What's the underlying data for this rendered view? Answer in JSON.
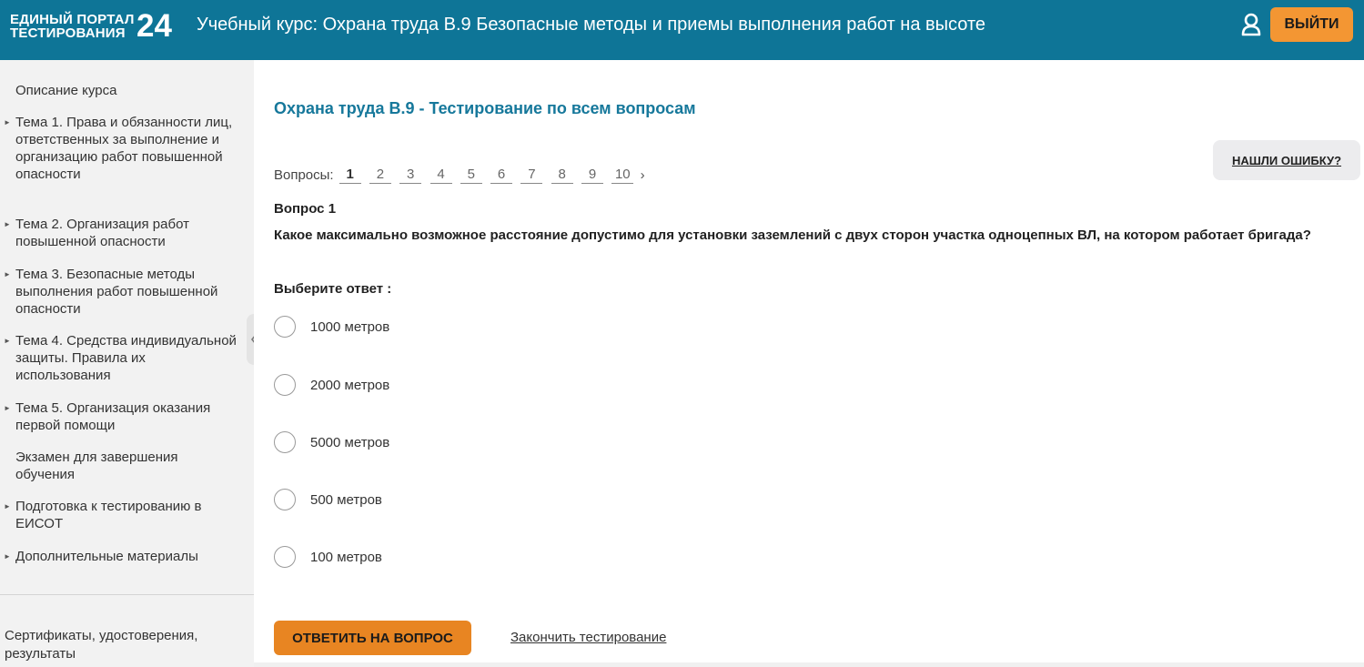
{
  "header": {
    "logo_line1": "ЕДИНЫЙ ПОРТАЛ",
    "logo_line2": "ТЕСТИРОВАНИЯ",
    "logo_number": "24",
    "title": "Учебный курс: Охрана труда В.9 Безопасные методы и приемы выполнения работ на высоте",
    "logout_label": "ВЫЙТИ",
    "user_icon": "user-icon"
  },
  "sidebar": {
    "items": [
      {
        "label": "Описание курса",
        "arrow": false
      },
      {
        "label": "Тема 1. Права и обязанности лиц, ответственных за выполнение и организацию работ повышенной опасности",
        "arrow": true
      },
      {
        "label": "Тема 2. Организация работ повышенной опасности",
        "arrow": true
      },
      {
        "label": "Тема 3. Безопасные методы выполнения работ повышенной опасности",
        "arrow": true
      },
      {
        "label": "Тема 4. Средства индивидуальной защиты. Правила их использования",
        "arrow": true
      },
      {
        "label": "Тема 5. Организация оказания первой помощи",
        "arrow": true
      },
      {
        "label": "Экзамен для завершения обучения",
        "arrow": false
      },
      {
        "label": "Подготовка к тестированию в ЕИСОТ",
        "arrow": true
      },
      {
        "label": "Дополнительные материалы",
        "arrow": true
      }
    ],
    "bottom_label": "Сертификаты, удостоверения, результаты"
  },
  "main": {
    "heading": "Охрана труда В.9 - Тестирование по всем вопросам",
    "report_error_label": "НАШЛИ ОШИБКУ?",
    "questions_label": "Вопросы:",
    "question_numbers": [
      "1",
      "2",
      "3",
      "4",
      "5",
      "6",
      "7",
      "8",
      "9",
      "10"
    ],
    "current_question": "1",
    "next_symbol": "›",
    "question_title": "Вопрос 1",
    "question_text": "Какое максимально возможное расстояние допустимо для установки заземлений с двух сторон участка одноцепных ВЛ, на котором работает бригада?",
    "select_label": "Выберите ответ :",
    "answers": [
      "1000 метров",
      "2000 метров",
      "5000 метров",
      "500 метров",
      "100 метров"
    ],
    "submit_label": "ОТВЕТИТЬ НА ВОПРОС",
    "finish_label": "Закончить тестирование"
  },
  "colors": {
    "header_bg": "#0e7597",
    "accent_orange": "#f39633",
    "heading_blue": "#16789b"
  }
}
